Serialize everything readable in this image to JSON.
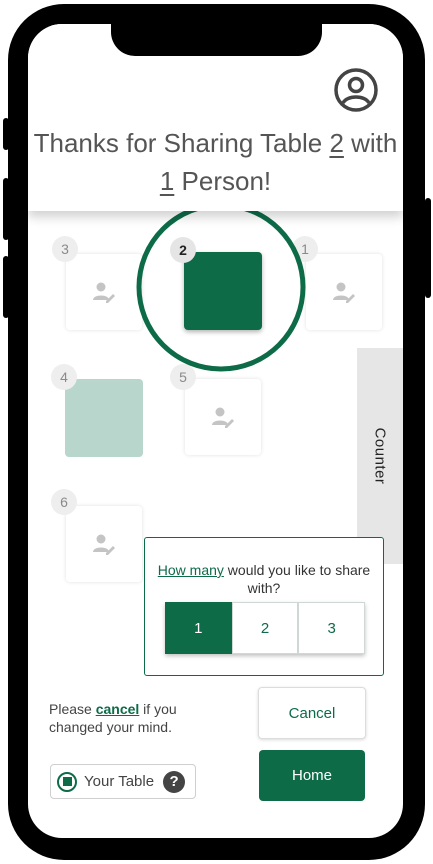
{
  "header": {
    "title_part1": "Thanks for Sharing Table ",
    "table_number": "2",
    "title_part2": " with",
    "people_count": "1",
    "title_part3": " Person!"
  },
  "tables": [
    {
      "number": "3",
      "state": "empty"
    },
    {
      "number": "2",
      "state": "yours-selected"
    },
    {
      "number": "1",
      "state": "empty"
    },
    {
      "number": "4",
      "state": "occupied"
    },
    {
      "number": "5",
      "state": "empty"
    },
    {
      "number": "6",
      "state": "empty"
    }
  ],
  "counter_label": "Counter",
  "share": {
    "question_link": "How many",
    "question_rest": " would you like to share with?",
    "options": [
      "1",
      "2",
      "3"
    ],
    "selected": "1"
  },
  "cancel_hint": {
    "prefix": "Please ",
    "link": "cancel",
    "suffix": " if you changed your mind."
  },
  "buttons": {
    "cancel": "Cancel",
    "home": "Home"
  },
  "legend": {
    "label": "Your Table",
    "help": "?"
  },
  "colors": {
    "brand_green": "#0d6b48",
    "occupied_green": "#b8d6cc",
    "counter_gray": "#e6e6e6"
  },
  "icons": {
    "profile": "account-circle-icon",
    "empty_seat": "person-edit-icon",
    "help": "question-circle-icon"
  }
}
